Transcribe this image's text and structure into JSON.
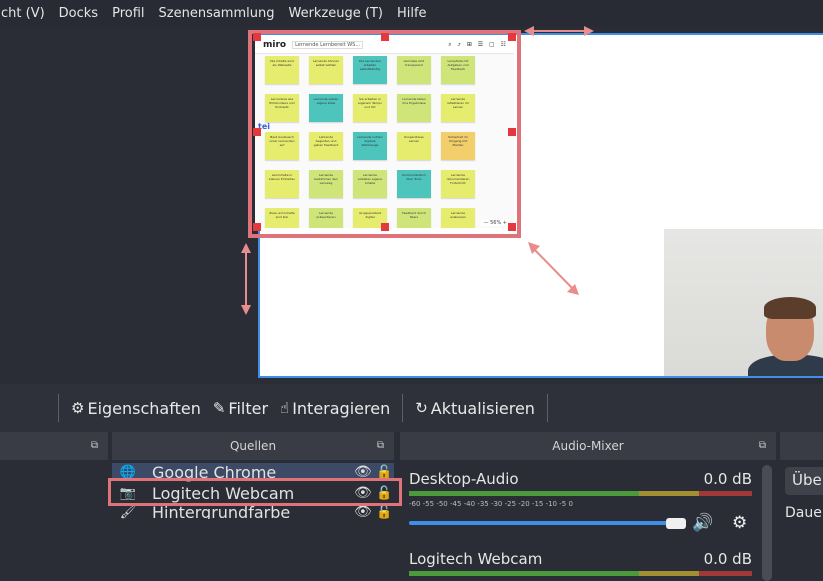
{
  "menubar": {
    "items": [
      "cht (V)",
      "Docks",
      "Profil",
      "Szenensammlung",
      "Werkzeuge (T)",
      "Hilfe"
    ]
  },
  "miro": {
    "logo": "miro",
    "board_title": "Lernende Lernbereit WS...",
    "tools": "⌕ ⤴ ⊞ ☰ ▢ ☷",
    "side_avatar": "tei",
    "bottom_bar": "— 56% +",
    "notes": [
      {
        "color": "y",
        "text": "Die Inhalte sind als Webseite"
      },
      {
        "color": "y",
        "text": "Lernende können selbst wählen"
      },
      {
        "color": "t",
        "text": "Die Lernenden arbeiten selbstständig"
      },
      {
        "color": "g",
        "text": "Lernziele sind transparent"
      },
      {
        "color": "g",
        "text": "Lernpfade mit Aufgaben und Feedback"
      },
      {
        "color": "y",
        "text": "Lernvideos wie Erklärvideos und Podcasts"
      },
      {
        "color": "t",
        "text": "Lernende setzen eigene Ziele"
      },
      {
        "color": "y",
        "text": "Sie arbeiten in eigenem Tempo und Ort"
      },
      {
        "color": "g",
        "text": "Lernende teilen ihre Ergebnisse"
      },
      {
        "color": "y",
        "text": "Lernende reflektieren ihr Lernen"
      },
      {
        "color": "y",
        "text": "Baut Austausch unter Lernenden auf"
      },
      {
        "color": "y",
        "text": "Lehrende begleiten und geben Feedback"
      },
      {
        "color": "t",
        "text": "Lernende nutzen digitale Werkzeuge"
      },
      {
        "color": "y",
        "text": "Kooperatives Lernen"
      },
      {
        "color": "o",
        "text": "Sicherheit im Umgang mit Medien"
      },
      {
        "color": "y",
        "text": "Lerninhalte in kleinen Einheiten"
      },
      {
        "color": "g",
        "text": "Lernende bestimmen den Lernweg"
      },
      {
        "color": "g",
        "text": "Lernende erstellen eigene Inhalte"
      },
      {
        "color": "t",
        "text": "Kommunikation über Tools"
      },
      {
        "color": "y",
        "text": "Lernende dokumentieren Fortschritt"
      },
      {
        "color": "y",
        "text": "Ziele und Inhalte sind klar"
      },
      {
        "color": "g",
        "text": "Lernende präsentieren"
      },
      {
        "color": "y",
        "text": "Gruppenarbeit digital"
      },
      {
        "color": "g",
        "text": "Feedback durch Peers"
      },
      {
        "color": "y",
        "text": "Lernende evaluieren"
      }
    ]
  },
  "toolbar": {
    "properties": {
      "icon": "⚙",
      "label": "Eigenschaften"
    },
    "filter": {
      "icon": "✎",
      "label": "Filter"
    },
    "interact": {
      "icon": "☝",
      "label": "Interagieren"
    },
    "refresh": {
      "icon": "↻",
      "label": "Aktualisieren"
    }
  },
  "docks": {
    "sources_title": "Quellen",
    "mixer_title": "Audio-Mixer",
    "undock_icon": "⧉"
  },
  "sources": [
    {
      "icon": "globe-icon",
      "glyph": "🌐",
      "name": "Google Chrome",
      "visible_glyph": "👁",
      "lock_glyph": "🔓",
      "selected": true
    },
    {
      "icon": "camera-icon",
      "glyph": "📷",
      "name": "Logitech Webcam",
      "visible_glyph": "👁",
      "lock_glyph": "🔓",
      "selected": false
    },
    {
      "icon": "brush-icon",
      "glyph": "🖌",
      "name": "Hintergrundfarbe",
      "visible_glyph": "👁",
      "lock_glyph": "🔓",
      "selected": false
    }
  ],
  "mixer": {
    "channels": [
      {
        "name": "Desktop-Audio",
        "level": "0.0 dB",
        "ticks": "-60  -55  -50  -45  -40  -35  -30  -25  -20  -15  -10   -5    0",
        "volume": 1.0
      },
      {
        "name": "Logitech Webcam",
        "level": "0.0 dB"
      }
    ],
    "speaker_glyph": "🔊",
    "gear_glyph": "⚙"
  },
  "right_panel": {
    "button_label": "Übe",
    "text": "Daue"
  },
  "colors": {
    "accent_blue": "#3d8fe8",
    "highlight_red": "#e0737a",
    "handle_red": "#e5383e"
  }
}
